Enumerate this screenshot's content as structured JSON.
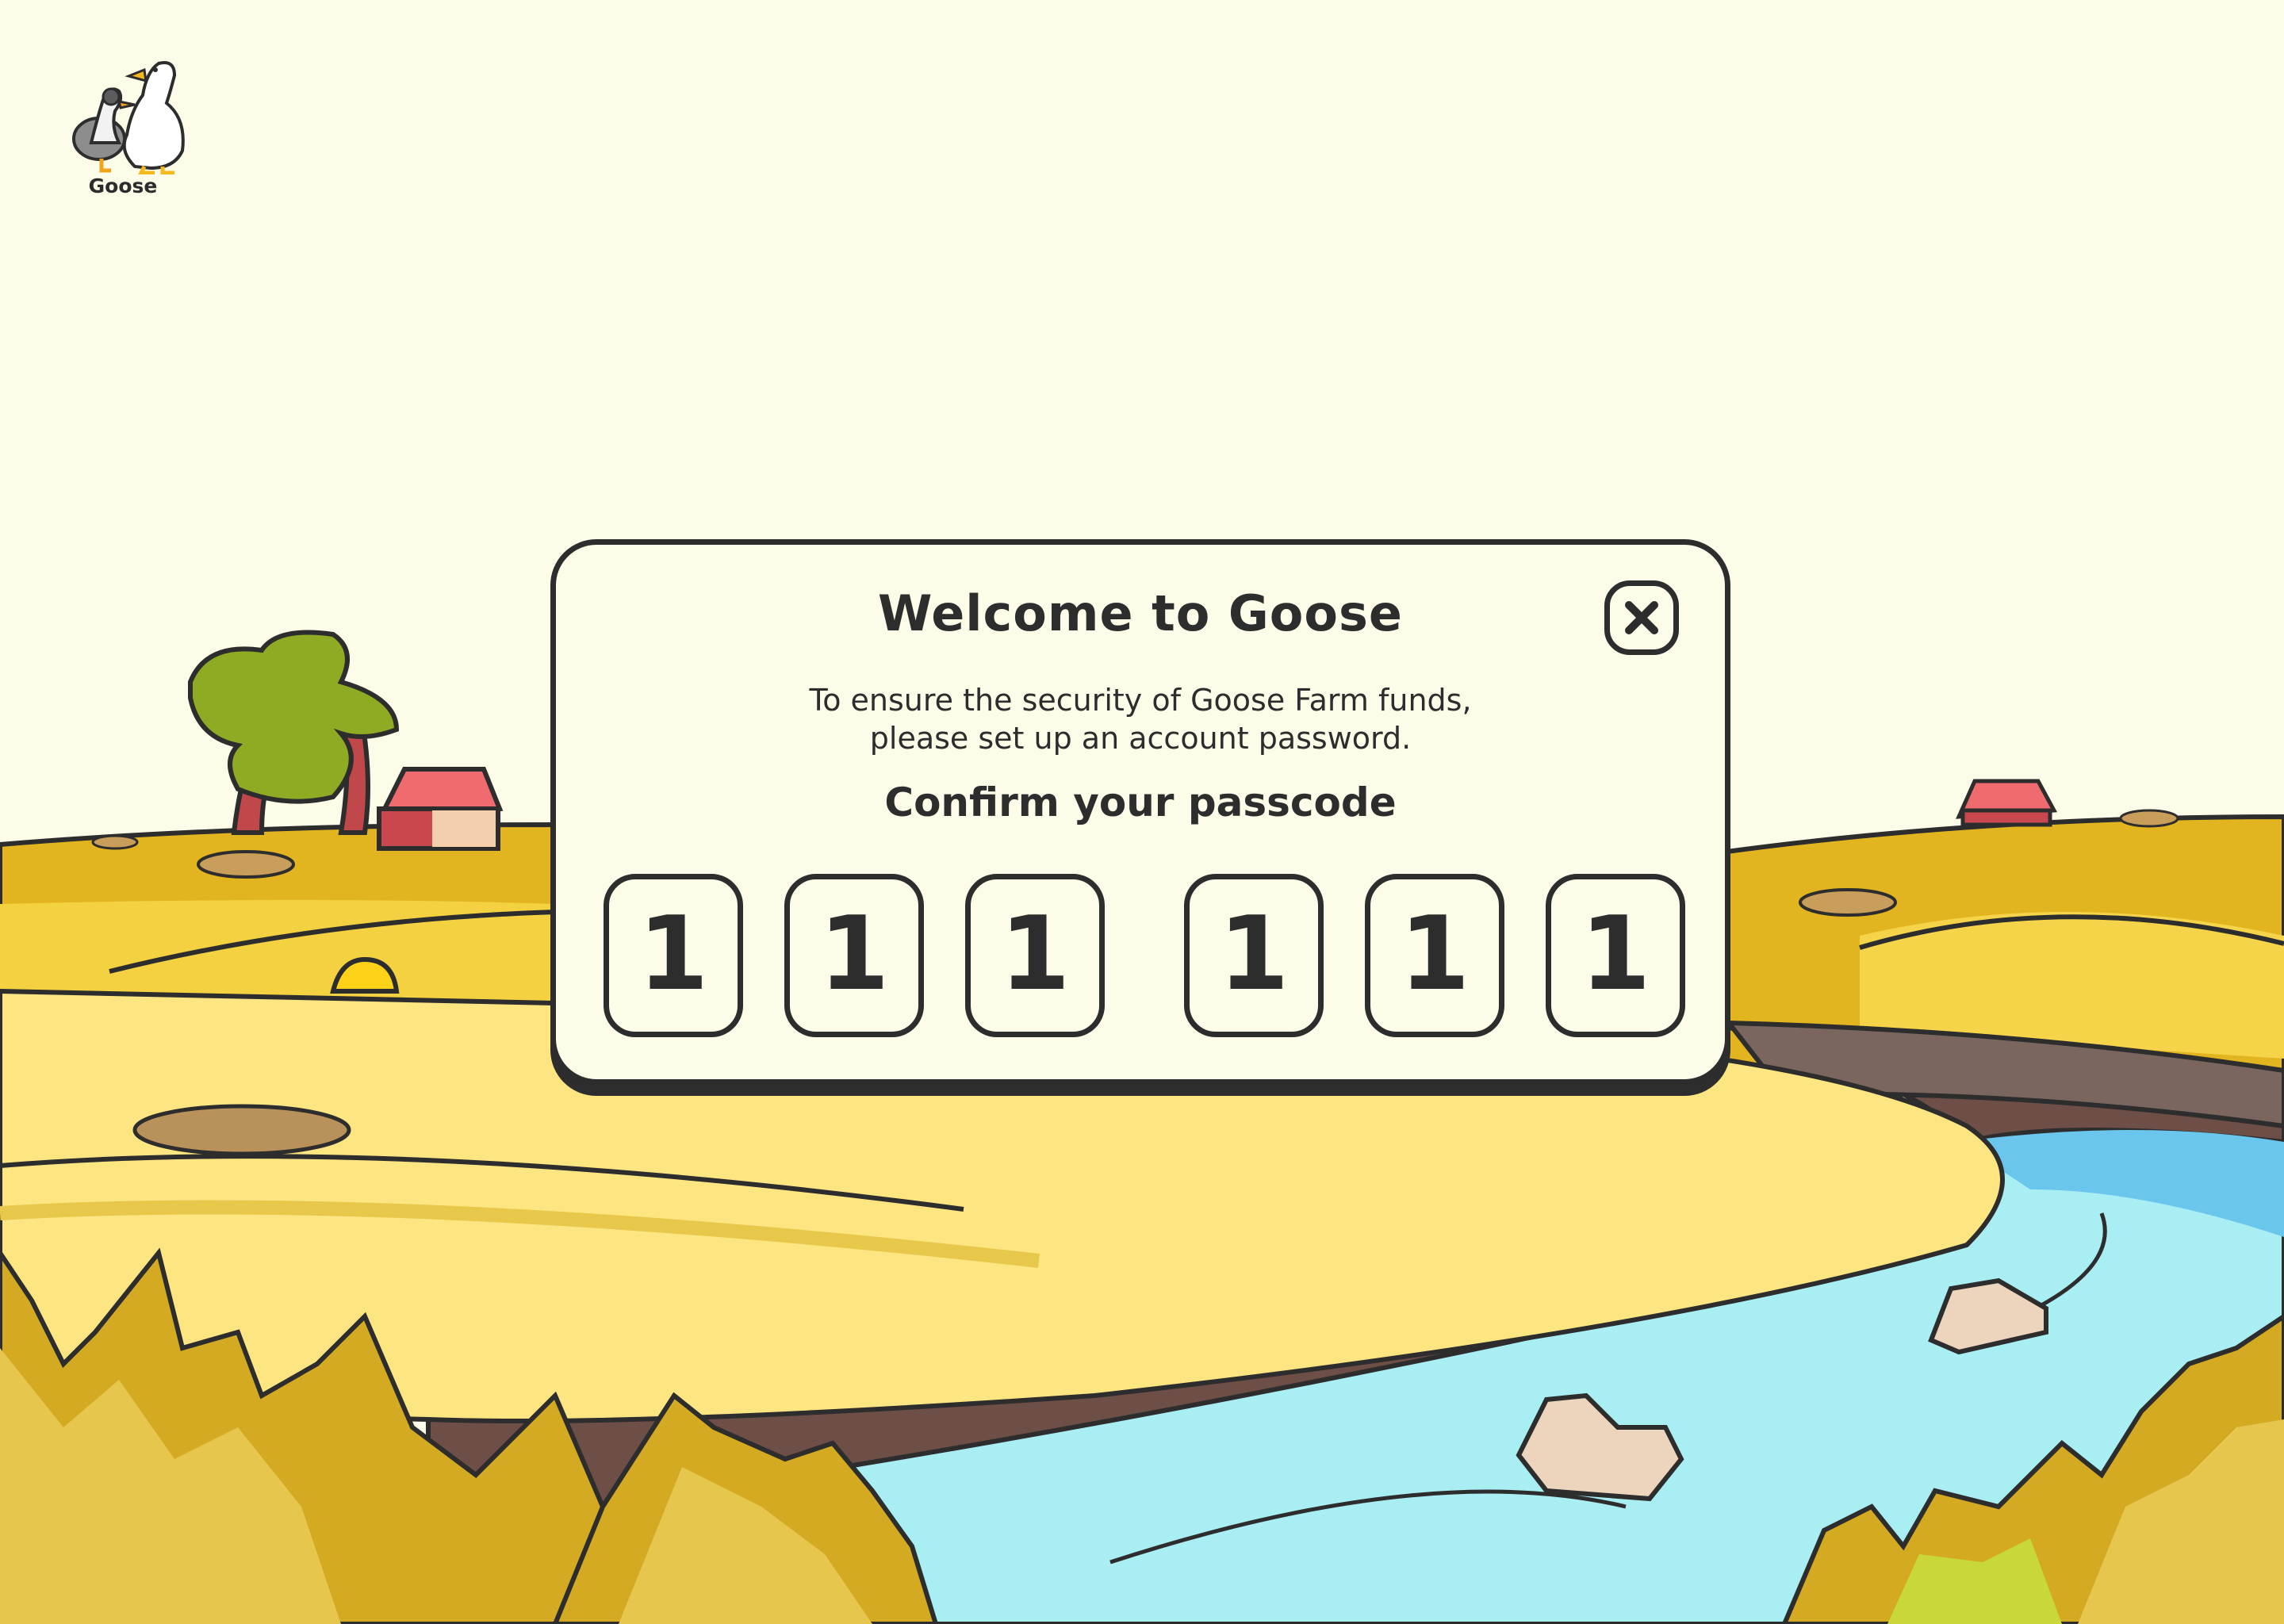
{
  "app": {
    "logo_label": "Goose"
  },
  "dialog": {
    "title": "Welcome to Goose",
    "message_line1": "To ensure the security of Goose Farm funds,",
    "message_line2": "please set up an account password.",
    "confirm_label": "Confirm your passcode",
    "passcode_digits": [
      "1",
      "1",
      "1",
      "1",
      "1",
      "1"
    ]
  },
  "icons": {
    "close": "close-icon",
    "logo": "goose-logo-icon"
  },
  "colors": {
    "background": "#fcfce9",
    "outline": "#2d2d2d",
    "field_yellow": "#f2c93a",
    "river_blue": "#a8eef2",
    "roof_red": "#f06b70"
  }
}
